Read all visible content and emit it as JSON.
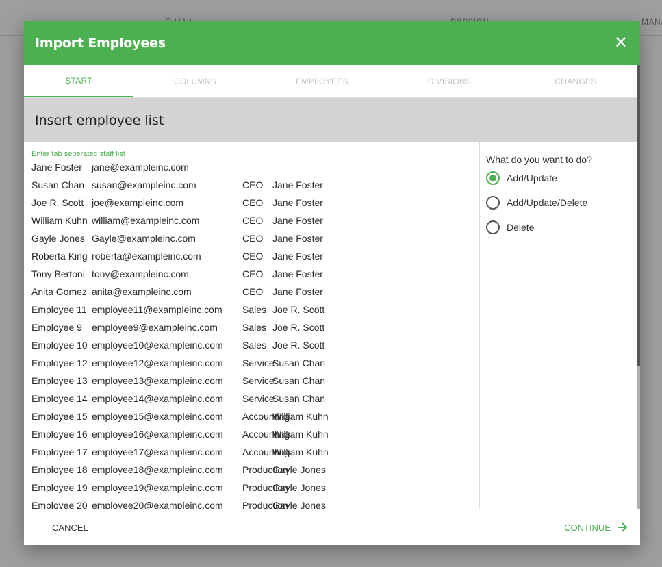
{
  "background": {
    "columns": [
      "E-MAIL",
      "DIVISION",
      "MANAGER"
    ]
  },
  "dialog": {
    "title": "Import Employees",
    "tabs": [
      "Start",
      "Columns",
      "Employees",
      "Divisions",
      "Changes"
    ],
    "active_tab": "Start",
    "section_title": "Insert employee list",
    "hint": "Enter tab seperated staff list",
    "rows": [
      [
        "Jane Foster",
        "jane@exampleinc.com",
        "",
        ""
      ],
      [
        "Susan Chan",
        "susan@exampleinc.com",
        "CEO",
        "Jane Foster"
      ],
      [
        "Joe R. Scott",
        "joe@exampleinc.com",
        "CEO",
        "Jane Foster"
      ],
      [
        "William Kuhn",
        "william@exampleinc.com",
        "CEO",
        "Jane Foster"
      ],
      [
        "Gayle Jones",
        "Gayle@exampleinc.com",
        "CEO",
        "Jane Foster"
      ],
      [
        "Roberta King",
        "roberta@exampleinc.com",
        "CEO",
        "Jane Foster"
      ],
      [
        "Tony Bertoni",
        "tony@exampleinc.com",
        "CEO",
        "Jane Foster"
      ],
      [
        "Anita Gomez",
        "anita@exampleinc.com",
        "CEO",
        "Jane Foster"
      ],
      [
        "Employee  11",
        "employee11@exampleinc.com",
        "Sales",
        "Joe R. Scott"
      ],
      [
        "Employee  9",
        "employee9@exampleinc.com",
        "Sales",
        "Joe R. Scott"
      ],
      [
        "Employee  10",
        "employee10@exampleinc.com",
        "Sales",
        "Joe R. Scott"
      ],
      [
        "Employee  12",
        "employee12@exampleinc.com",
        "Service",
        "Susan Chan"
      ],
      [
        "Employee  13",
        "employee13@exampleinc.com",
        "Service",
        "Susan Chan"
      ],
      [
        "Employee  14",
        "employee14@exampleinc.com",
        "Service",
        "Susan Chan"
      ],
      [
        "Employee  15",
        "employee15@exampleinc.com",
        "Accounting",
        "William Kuhn"
      ],
      [
        "Employee  16",
        "employee16@exampleinc.com",
        "Accounting",
        "William Kuhn"
      ],
      [
        "Employee  17",
        "employee17@exampleinc.com",
        "Accounting",
        "William Kuhn"
      ],
      [
        "Employee  18",
        "employee18@exampleinc.com",
        "Production",
        "Gayle Jones"
      ],
      [
        "Employee  19",
        "employee19@exampleinc.com",
        "Production",
        "Gayle Jones"
      ],
      [
        "Employee  20",
        "employee20@exampleinc.com",
        "Production",
        "Gayle Jones"
      ]
    ],
    "question": "What do you want to do?",
    "options": [
      "Add/Update",
      "Add/Update/Delete",
      "Delete"
    ],
    "selected_option": "Add/Update",
    "cancel_label": "Cancel",
    "continue_label": "Continue",
    "accent_color": "#4caf50",
    "icons": {
      "close": "close-icon",
      "continue": "arrow-right-icon"
    }
  }
}
